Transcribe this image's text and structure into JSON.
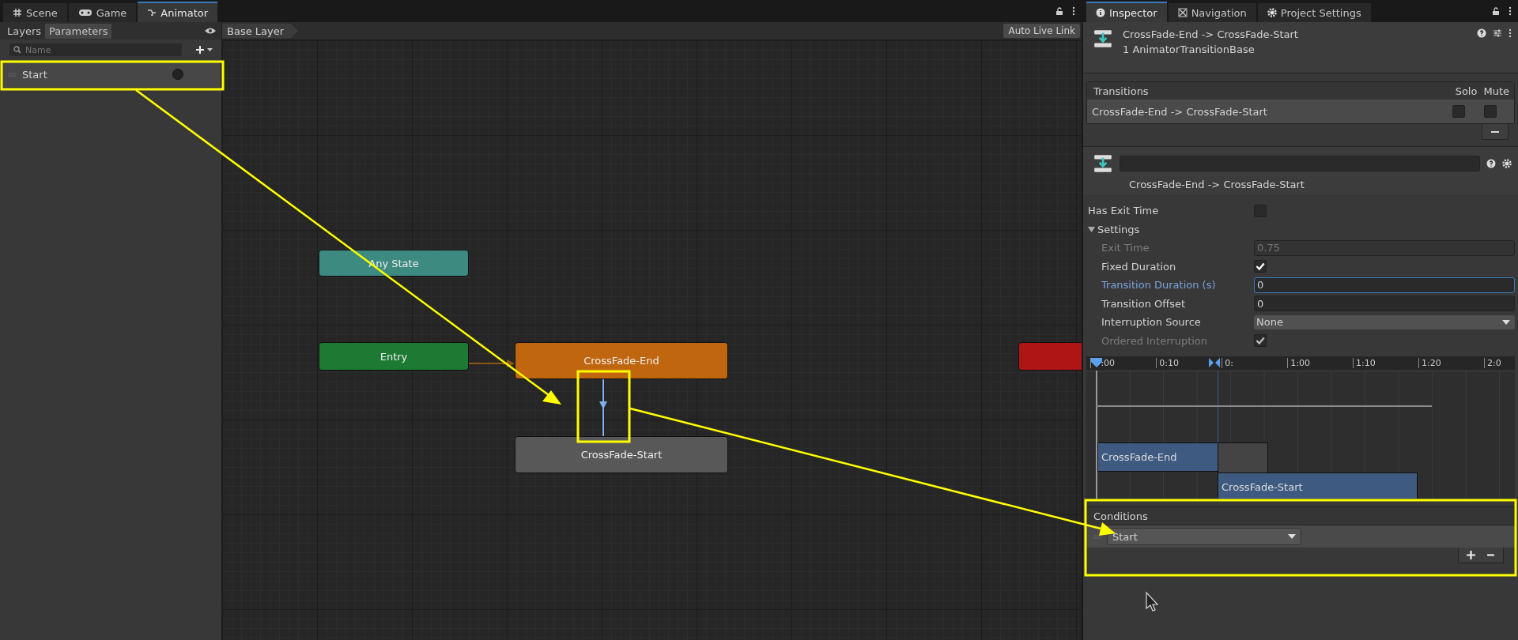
{
  "editor_tabs": [
    {
      "label": "Scene",
      "selected": false
    },
    {
      "label": "Game",
      "selected": false
    },
    {
      "label": "Animator",
      "selected": true
    }
  ],
  "animator": {
    "subtabs": [
      {
        "label": "Layers",
        "selected": false
      },
      {
        "label": "Parameters",
        "selected": true
      }
    ],
    "search": {
      "placeholder": "Name"
    },
    "parameters": [
      {
        "name": "Start",
        "kind": "trigger",
        "on": false
      }
    ],
    "breadcrumb": "Base Layer",
    "live_link_button": "Auto Live Link",
    "nodes": [
      {
        "label": "Any State",
        "kind": "any"
      },
      {
        "label": "Entry",
        "kind": "entry"
      },
      {
        "label": "CrossFade-End",
        "kind": "default"
      },
      {
        "label": "CrossFade-Start",
        "kind": "state"
      },
      {
        "kind": "exit"
      }
    ]
  },
  "inspector": {
    "tabs": [
      {
        "label": "Inspector",
        "selected": true
      },
      {
        "label": "Navigation",
        "selected": false
      },
      {
        "label": "Project Settings",
        "selected": false
      }
    ],
    "title": "CrossFade-End -> CrossFade-Start",
    "subtitle": "1 AnimatorTransitionBase",
    "transitions": {
      "header": "Transitions",
      "solo_label": "Solo",
      "mute_label": "Mute",
      "rows": [
        {
          "name": "CrossFade-End -> CrossFade-Start",
          "solo": false,
          "mute": false
        }
      ]
    },
    "transition_name": "CrossFade-End -> CrossFade-Start",
    "has_exit_time": {
      "label": "Has Exit Time",
      "checked": false
    },
    "settings": {
      "label": "Settings",
      "expanded": true,
      "fields": [
        {
          "kind": "number",
          "label": "Exit Time",
          "value": "0.75",
          "disabled": true,
          "focused": false
        },
        {
          "kind": "checkbox",
          "label": "Fixed Duration",
          "checked": true,
          "disabled": false,
          "focused": false
        },
        {
          "kind": "number",
          "label": "Transition Duration (s)",
          "value": "0",
          "disabled": false,
          "focused": true
        },
        {
          "kind": "number",
          "label": "Transition Offset",
          "value": "0",
          "disabled": false,
          "focused": false
        },
        {
          "kind": "dropdown",
          "label": "Interruption Source",
          "value": "None",
          "disabled": false,
          "focused": false
        },
        {
          "kind": "checkbox",
          "label": "Ordered Interruption",
          "checked": true,
          "disabled": true,
          "focused": false
        }
      ]
    },
    "timeline": {
      "ticks": [
        ":00",
        "0:10",
        "0:",
        "1:00",
        "1:10",
        "1:20",
        "2:0"
      ],
      "clips": [
        {
          "name": "CrossFade-End"
        },
        {
          "name": "CrossFade-Start"
        }
      ]
    },
    "conditions": {
      "header": "Conditions",
      "rows": [
        {
          "parameter": "Start"
        }
      ]
    }
  }
}
